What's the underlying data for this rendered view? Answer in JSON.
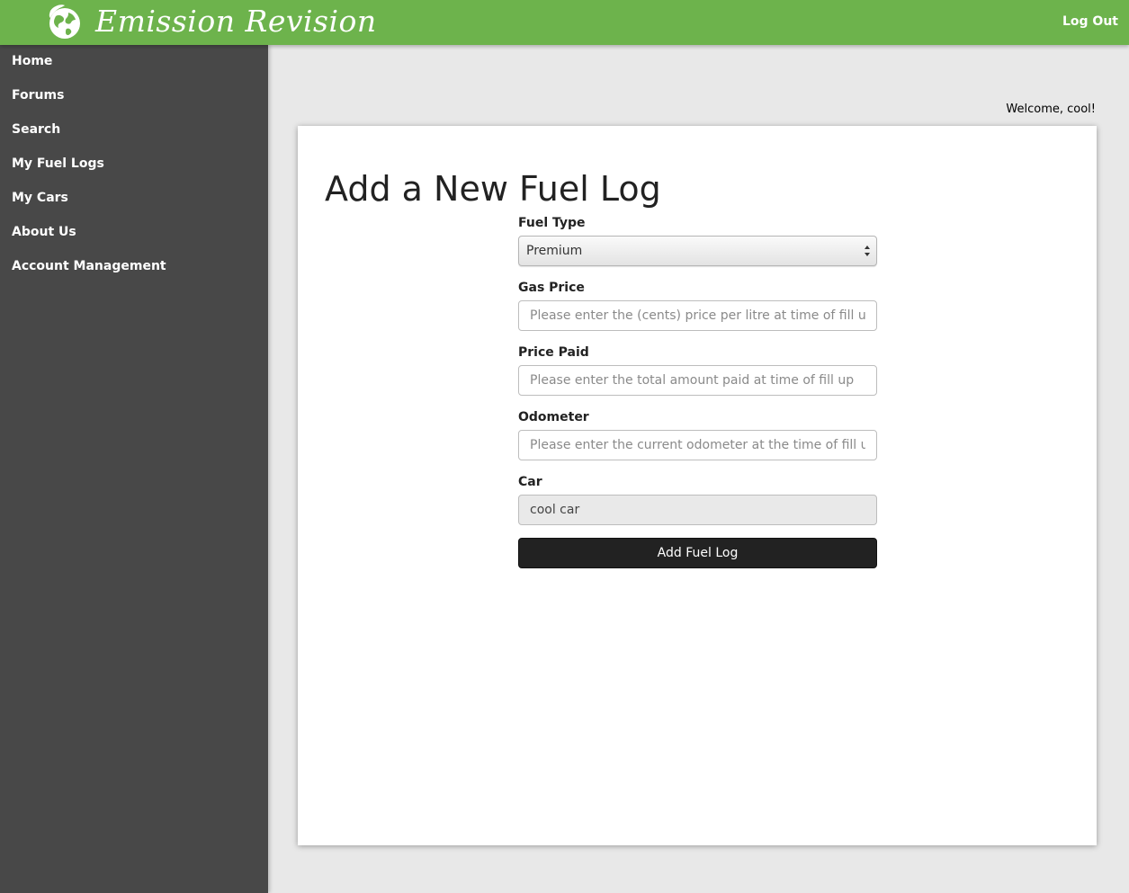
{
  "header": {
    "brand": "Emission Revision",
    "logout_label": "Log Out",
    "logo_icon": "globe-leaf-icon",
    "bar_color": "#6db34c"
  },
  "sidebar": {
    "bg_color": "#484848",
    "items": [
      {
        "label": "Home"
      },
      {
        "label": "Forums"
      },
      {
        "label": "Search"
      },
      {
        "label": "My Fuel Logs"
      },
      {
        "label": "My Cars"
      },
      {
        "label": "About Us"
      },
      {
        "label": "Account Management"
      }
    ]
  },
  "welcome_text": "Welcome, cool!",
  "main": {
    "title": "Add a New Fuel Log",
    "fuel_type": {
      "label": "Fuel Type",
      "value": "Premium"
    },
    "gas_price": {
      "label": "Gas Price",
      "placeholder": "Please enter the (cents) price per litre at time of fill up"
    },
    "price_paid": {
      "label": "Price Paid",
      "placeholder": "Please enter the total amount paid at time of fill up"
    },
    "odometer": {
      "label": "Odometer",
      "placeholder": "Please enter the current odometer at the time of fill up"
    },
    "car": {
      "label": "Car",
      "value": "cool car"
    },
    "submit_label": "Add Fuel Log"
  }
}
